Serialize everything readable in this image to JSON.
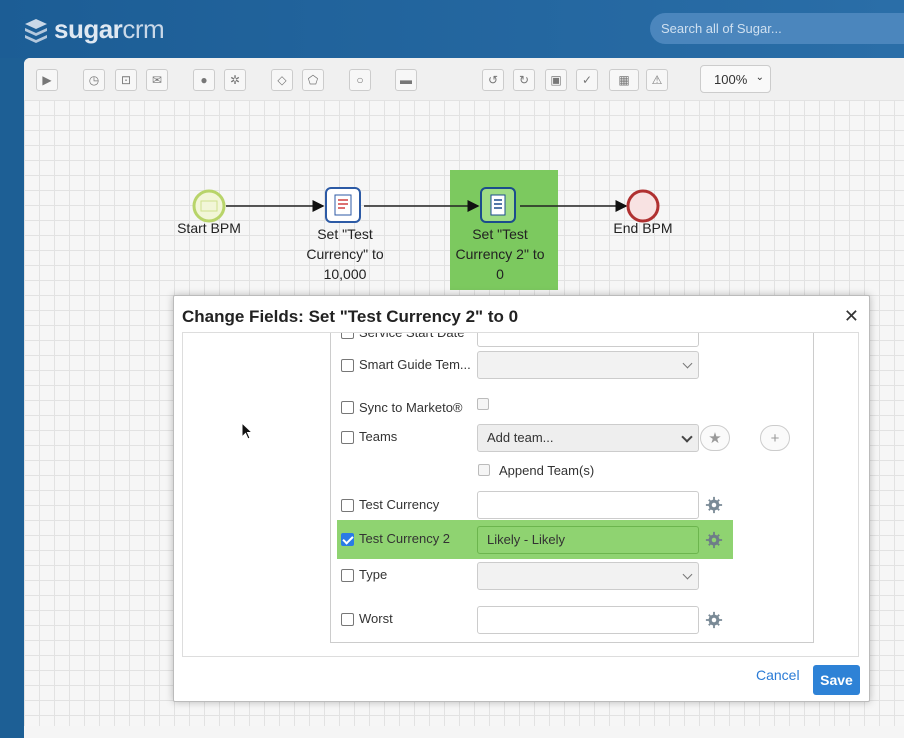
{
  "app": {
    "logo_bold": "sugar",
    "logo_light": "crm"
  },
  "search": {
    "placeholder": "Search all of Sugar..."
  },
  "toolbar": {
    "zoom": "100%"
  },
  "flow": {
    "start_label": "Start BPM",
    "task1_lines": [
      "Set \"Test",
      "Currency\" to",
      "10,000"
    ],
    "task2_lines": [
      "Set \"Test",
      "Currency 2\" to",
      "0"
    ],
    "end_label": "End BPM"
  },
  "modal": {
    "title": "Change Fields: Set \"Test Currency 2\" to 0",
    "cancel": "Cancel",
    "save": "Save",
    "fields": {
      "service_start": "Service Start Date",
      "smart_guide": "Smart Guide Tem...",
      "sync_marketo": "Sync to Marketo®",
      "teams": "Teams",
      "teams_placeholder": "Add team...",
      "append_teams": "Append Team(s)",
      "test_currency": "Test Currency",
      "test_currency2": "Test Currency 2",
      "test_currency2_value": "Likely - Likely",
      "type": "Type",
      "worst": "Worst"
    }
  },
  "colors": {
    "brand": "#1d5f95",
    "highlight": "#8fd371",
    "save": "#2e82d6"
  }
}
